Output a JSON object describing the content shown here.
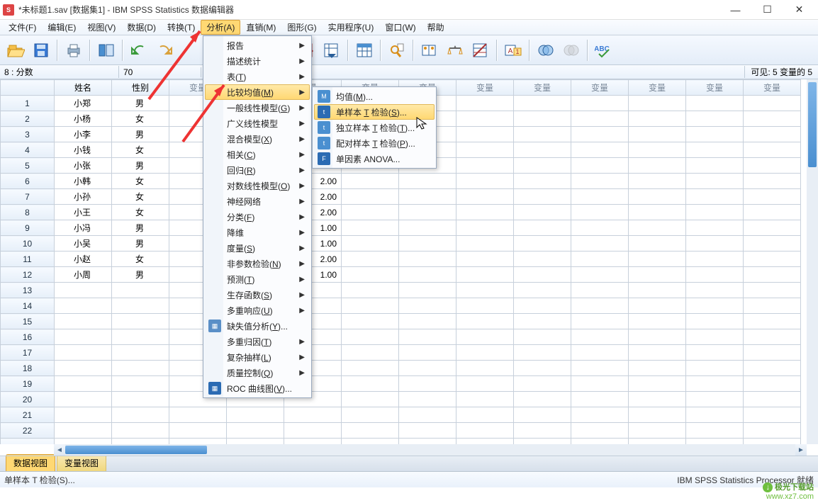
{
  "title": "*未标题1.sav [数据集1] - IBM SPSS Statistics 数据编辑器",
  "window_buttons": {
    "min": "—",
    "max": "☐",
    "close": "✕"
  },
  "menubar": [
    "文件(F)",
    "编辑(E)",
    "视图(V)",
    "数据(D)",
    "转换(T)",
    "分析(A)",
    "直销(M)",
    "图形(G)",
    "实用程序(U)",
    "窗口(W)",
    "帮助"
  ],
  "menubar_active_index": 5,
  "infobar": {
    "cell_ref": "8 : 分数",
    "cell_val": "70",
    "visible": "可见: 5 变量的 5"
  },
  "columns_known": [
    "姓名",
    "性别"
  ],
  "columns_unknown_label": "变量",
  "data_rows": [
    {
      "n": "1",
      "name": "小郑",
      "sex": "男",
      "score": ""
    },
    {
      "n": "2",
      "name": "小杨",
      "sex": "女",
      "score": ""
    },
    {
      "n": "3",
      "name": "小李",
      "sex": "男",
      "score": ""
    },
    {
      "n": "4",
      "name": "小钱",
      "sex": "女",
      "score": ""
    },
    {
      "n": "5",
      "name": "小张",
      "sex": "男",
      "score": ""
    },
    {
      "n": "6",
      "name": "小韩",
      "sex": "女",
      "score": "2.00"
    },
    {
      "n": "7",
      "name": "小孙",
      "sex": "女",
      "score": "2.00"
    },
    {
      "n": "8",
      "name": "小王",
      "sex": "女",
      "score": "2.00"
    },
    {
      "n": "9",
      "name": "小冯",
      "sex": "男",
      "score": "1.00"
    },
    {
      "n": "10",
      "name": "小吴",
      "sex": "男",
      "score": "1.00"
    },
    {
      "n": "11",
      "name": "小赵",
      "sex": "女",
      "score": "2.00"
    },
    {
      "n": "12",
      "name": "小周",
      "sex": "男",
      "score": "1.00"
    }
  ],
  "empty_rows": [
    "13",
    "14",
    "15",
    "16",
    "17",
    "18",
    "19",
    "20",
    "21",
    "22"
  ],
  "analyze_menu": [
    {
      "label": "报告",
      "arrow": true
    },
    {
      "label": "描述统计",
      "arrow": true
    },
    {
      "label": "表(T)",
      "arrow": true
    },
    {
      "label": "比较均值(M)",
      "arrow": true,
      "highlight": true
    },
    {
      "label": "一般线性模型(G)",
      "arrow": true
    },
    {
      "label": "广义线性模型",
      "arrow": true
    },
    {
      "label": "混合模型(X)",
      "arrow": true
    },
    {
      "label": "相关(C)",
      "arrow": true
    },
    {
      "label": "回归(R)",
      "arrow": true
    },
    {
      "label": "对数线性模型(O)",
      "arrow": true
    },
    {
      "label": "神经网络",
      "arrow": true
    },
    {
      "label": "分类(F)",
      "arrow": true
    },
    {
      "label": "降维",
      "arrow": true
    },
    {
      "label": "度量(S)",
      "arrow": true
    },
    {
      "label": "非参数检验(N)",
      "arrow": true
    },
    {
      "label": "预测(T)",
      "arrow": true
    },
    {
      "label": "生存函数(S)",
      "arrow": true
    },
    {
      "label": "多重响应(U)",
      "arrow": true
    },
    {
      "label": "缺失值分析(Y)...",
      "arrow": false,
      "icon": "#5a8fc7"
    },
    {
      "label": "多重归因(T)",
      "arrow": true
    },
    {
      "label": "复杂抽样(L)",
      "arrow": true
    },
    {
      "label": "质量控制(Q)",
      "arrow": true
    },
    {
      "label": "ROC 曲线图(V)...",
      "arrow": false,
      "icon": "#2b6bb3"
    }
  ],
  "compare_means_menu": [
    {
      "label": "均值(M)...",
      "icon": "#4a8fd0",
      "letter": "M"
    },
    {
      "label": "单样本 T 检验(S)...",
      "icon": "#2b6bb3",
      "letter": "t",
      "highlight": true
    },
    {
      "label": "独立样本 T 检验(T)...",
      "icon": "#4a8fd0",
      "letter": "t"
    },
    {
      "label": "配对样本 T 检验(P)...",
      "icon": "#4a8fd0",
      "letter": "t"
    },
    {
      "label": "单因素 ANOVA...",
      "icon": "#2b6bb3",
      "letter": "F"
    }
  ],
  "view_tabs": {
    "data": "数据视图",
    "var": "变量视图"
  },
  "status": {
    "left": "单样本 T 检验(S)...",
    "right": "IBM SPSS Statistics Processor 就绪"
  },
  "watermark": {
    "line1": "极光下载站",
    "line2": "www.xz7.com"
  }
}
